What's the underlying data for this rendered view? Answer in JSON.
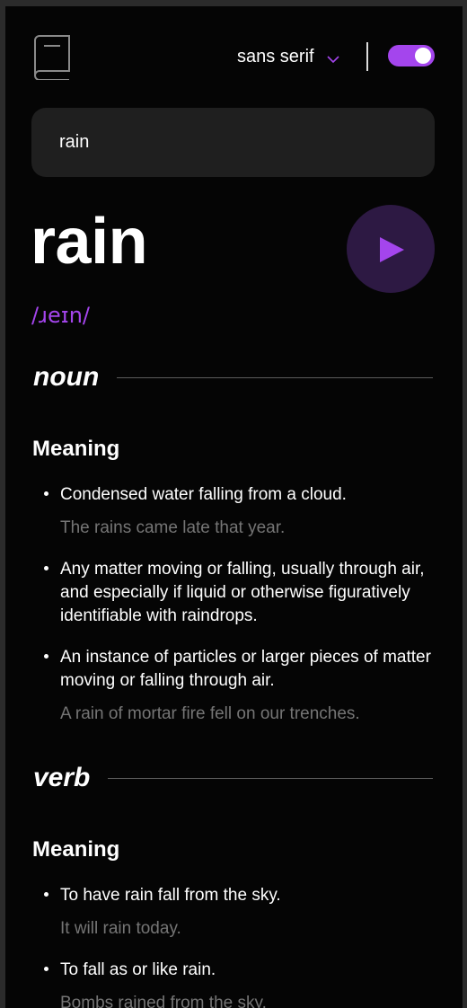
{
  "header": {
    "logo_icon": "book-icon",
    "font_select": {
      "label": "sans serif",
      "icon": "chevron-down-icon"
    },
    "theme_toggle": {
      "state": "on",
      "color": "#a445ed"
    }
  },
  "search": {
    "value": "rain",
    "icon": "search-icon"
  },
  "entry": {
    "word": "rain",
    "phonetic": "/ɹeɪn/",
    "play_icon": "play-icon",
    "accent_color": "#a445ed"
  },
  "meanings": [
    {
      "part_of_speech": "noun",
      "heading": "Meaning",
      "definitions": [
        {
          "text": "Condensed water falling from a cloud.",
          "example": "The rains came late that year."
        },
        {
          "text": "Any matter moving or falling, usually through air, and especially if liquid or otherwise figuratively identifiable with raindrops.",
          "example": ""
        },
        {
          "text": "An instance of particles or larger pieces of matter moving or falling through air.",
          "example": "A rain of mortar fire fell on our trenches."
        }
      ]
    },
    {
      "part_of_speech": "verb",
      "heading": "Meaning",
      "definitions": [
        {
          "text": "To have rain fall from the sky.",
          "example": "It will rain today."
        },
        {
          "text": "To fall as or like rain.",
          "example": "Bombs rained from the sky."
        }
      ]
    }
  ]
}
